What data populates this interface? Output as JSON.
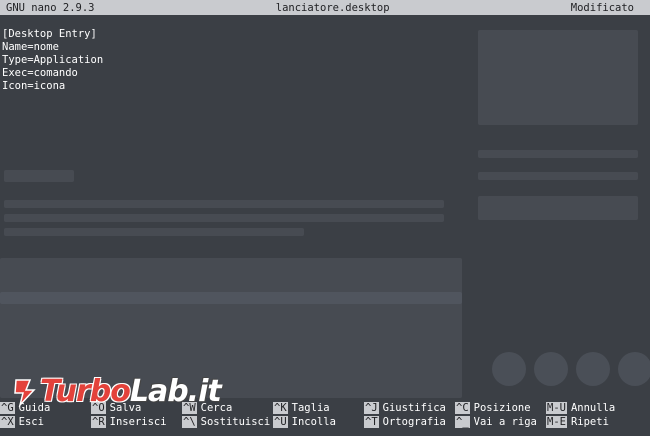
{
  "titlebar": {
    "app": "GNU nano 2.9.3",
    "filename": "lanciatore.desktop",
    "status": "Modificato"
  },
  "editor": {
    "lines": [
      "[Desktop Entry]",
      "Name=nome",
      "Type=Application",
      "Exec=comando",
      "Icon=icona"
    ]
  },
  "shortcuts": [
    {
      "key": "^G",
      "label": "Guida"
    },
    {
      "key": "^O",
      "label": "Salva"
    },
    {
      "key": "^W",
      "label": "Cerca"
    },
    {
      "key": "^K",
      "label": "Taglia"
    },
    {
      "key": "^J",
      "label": "Giustifica"
    },
    {
      "key": "^C",
      "label": "Posizione"
    },
    {
      "key": "M-U",
      "label": "Annulla"
    },
    {
      "key": "^X",
      "label": "Esci"
    },
    {
      "key": "^R",
      "label": "Inserisci"
    },
    {
      "key": "^\\",
      "label": "Sostituisci"
    },
    {
      "key": "^U",
      "label": "Incolla"
    },
    {
      "key": "^T",
      "label": "Ortografia"
    },
    {
      "key": "^_",
      "label": "Vai a riga"
    },
    {
      "key": "M-E",
      "label": "Ripeti"
    }
  ],
  "watermark": {
    "part1": "Turbo",
    "part2": "Lab.it"
  },
  "colors": {
    "background": "#3b3f45",
    "bar": "#c9cbcf",
    "logo_red": "#e3423b"
  }
}
